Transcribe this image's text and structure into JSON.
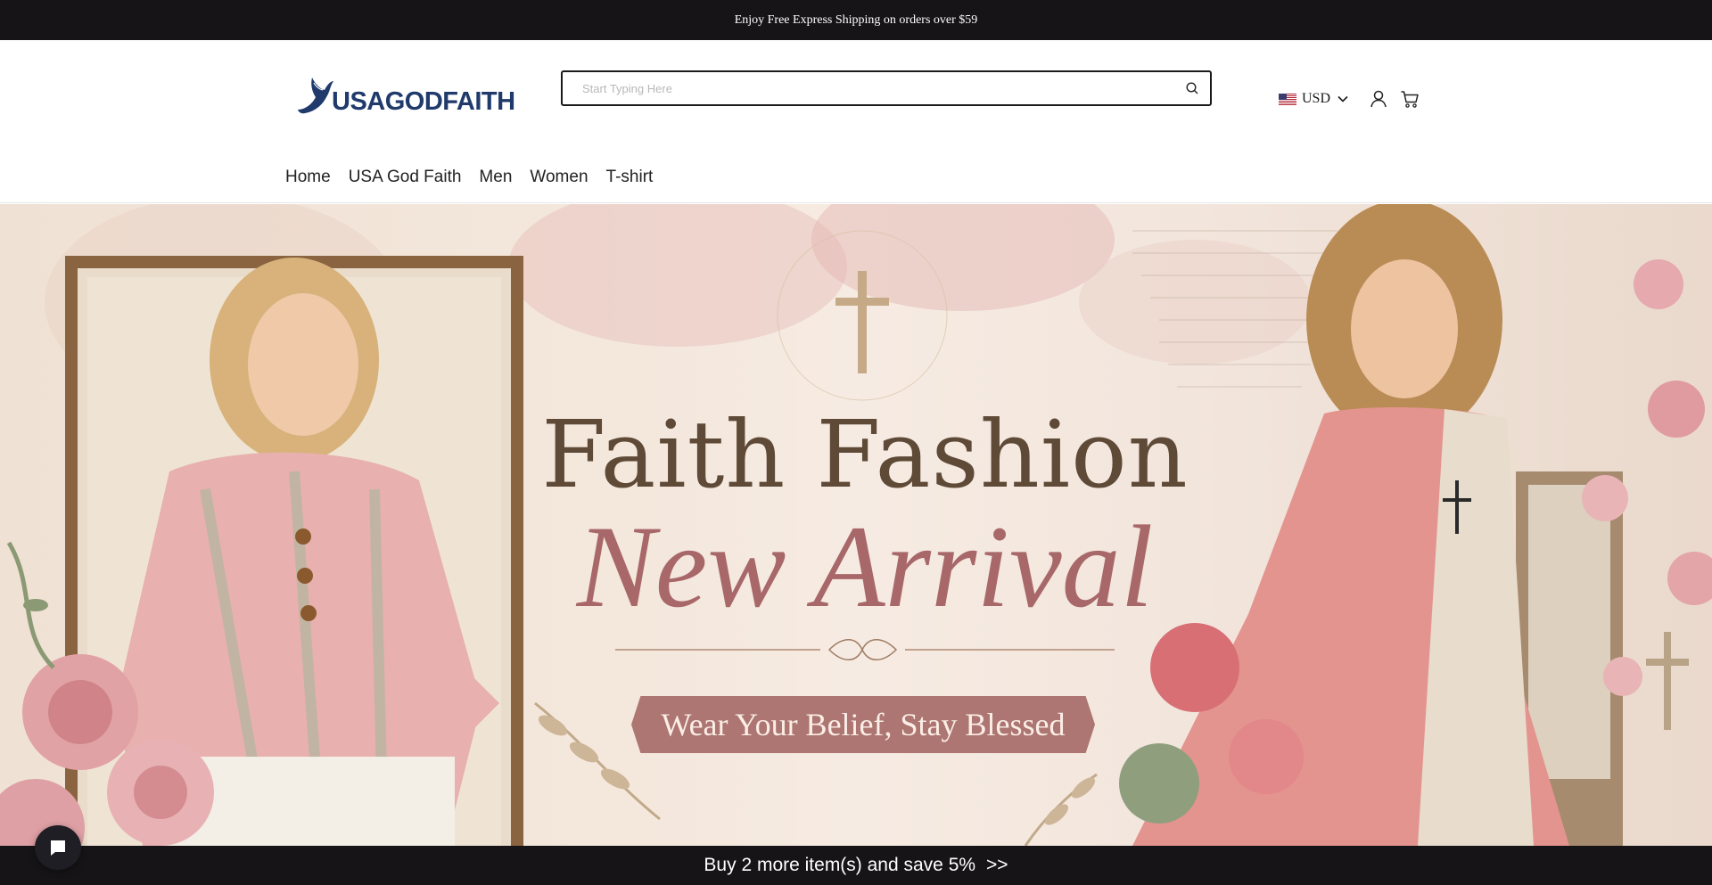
{
  "announcement": {
    "text": "Enjoy Free Express Shipping on orders over $59"
  },
  "header": {
    "logo_text": "USAGODFAITH",
    "search": {
      "placeholder": "Start Typing Here",
      "value": ""
    },
    "currency": {
      "label": "USD",
      "flag_icon": "us-flag-icon"
    },
    "icons": [
      "search-icon",
      "user-icon",
      "cart-icon",
      "chevron-down-icon"
    ]
  },
  "nav": {
    "items": [
      {
        "label": "Home"
      },
      {
        "label": "USA God Faith"
      },
      {
        "label": "Men"
      },
      {
        "label": "Women"
      },
      {
        "label": "T-shirt"
      }
    ]
  },
  "hero": {
    "title": "Faith Fashion",
    "script_title": "New Arrival",
    "tagline": "Wear Your Belief, Stay Blessed"
  },
  "promo_bar": {
    "text": "Buy 2 more item(s) and save 5%",
    "arrows": ">>"
  },
  "chat": {
    "icon": "chat-bubble-icon"
  },
  "colors": {
    "topbar_bg": "#161416",
    "logo_blue": "#1f3a6b",
    "hero_title": "#5e4a37",
    "hero_script": "#a8686a",
    "ribbon": "#ad7672"
  }
}
